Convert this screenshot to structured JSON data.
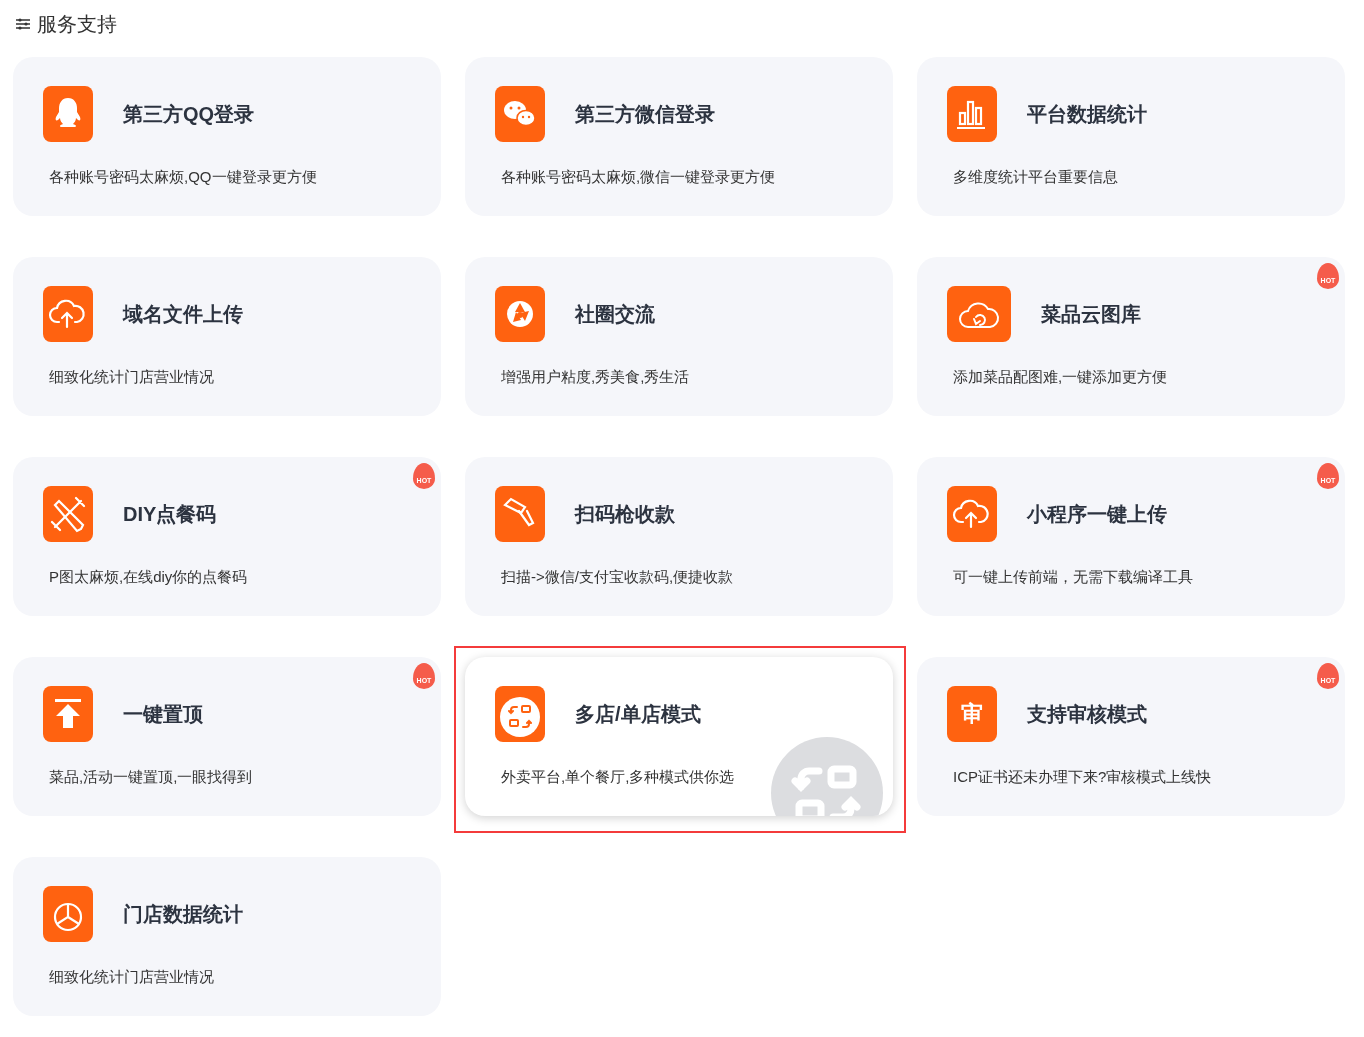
{
  "section": {
    "title": "服务支持"
  },
  "cards": [
    {
      "kind": "qq",
      "title": "第三方QQ登录",
      "desc": "各种账号密码太麻烦,QQ一键登录更方便",
      "selected": false
    },
    {
      "kind": "wechat",
      "title": "第三方微信登录",
      "desc": "各种账号密码太麻烦,微信一键登录更方便",
      "selected": false
    },
    {
      "kind": "bars",
      "title": "平台数据统计",
      "desc": "多维度统计平台重要信息",
      "selected": false
    },
    {
      "kind": "upload",
      "title": "域名文件上传",
      "desc": "细致化统计门店营业情况",
      "selected": false
    },
    {
      "kind": "aperture",
      "title": "社圈交流",
      "desc": "增强用户粘度,秀美食,秀生活",
      "selected": false
    },
    {
      "kind": "download",
      "title": "菜品云图库",
      "desc": "添加菜品配图难,一键添加更方便",
      "badge": "HOT",
      "selected": false
    },
    {
      "kind": "tools",
      "title": "DIY点餐码",
      "desc": "P图太麻烦,在线diy你的点餐码",
      "badge": "HOT",
      "selected": false
    },
    {
      "kind": "scanner",
      "title": "扫码枪收款",
      "desc": "扫描->微信/支付宝收款码,便捷收款",
      "selected": false
    },
    {
      "kind": "upload",
      "title": "小程序一键上传",
      "desc": "可一键上传前端，无需下载编译工具",
      "badge": "HOT",
      "selected": false
    },
    {
      "kind": "pin",
      "title": "一键置顶",
      "desc": "菜品,活动一键置顶,一眼找得到",
      "badge": "HOT",
      "selected": false
    },
    {
      "kind": "swap",
      "title": "多店/单店模式",
      "desc": "外卖平台,单个餐厅,多种模式供你选",
      "selected": true
    },
    {
      "kind": "glyph",
      "icon_char": "审",
      "title": "支持审核模式",
      "desc": "ICP证书还未办理下来?审核模式上线快",
      "badge": "HOT",
      "selected": false
    },
    {
      "kind": "pie",
      "title": "门店数据统计",
      "desc": "细致化统计门店营业情况",
      "selected": false
    }
  ]
}
